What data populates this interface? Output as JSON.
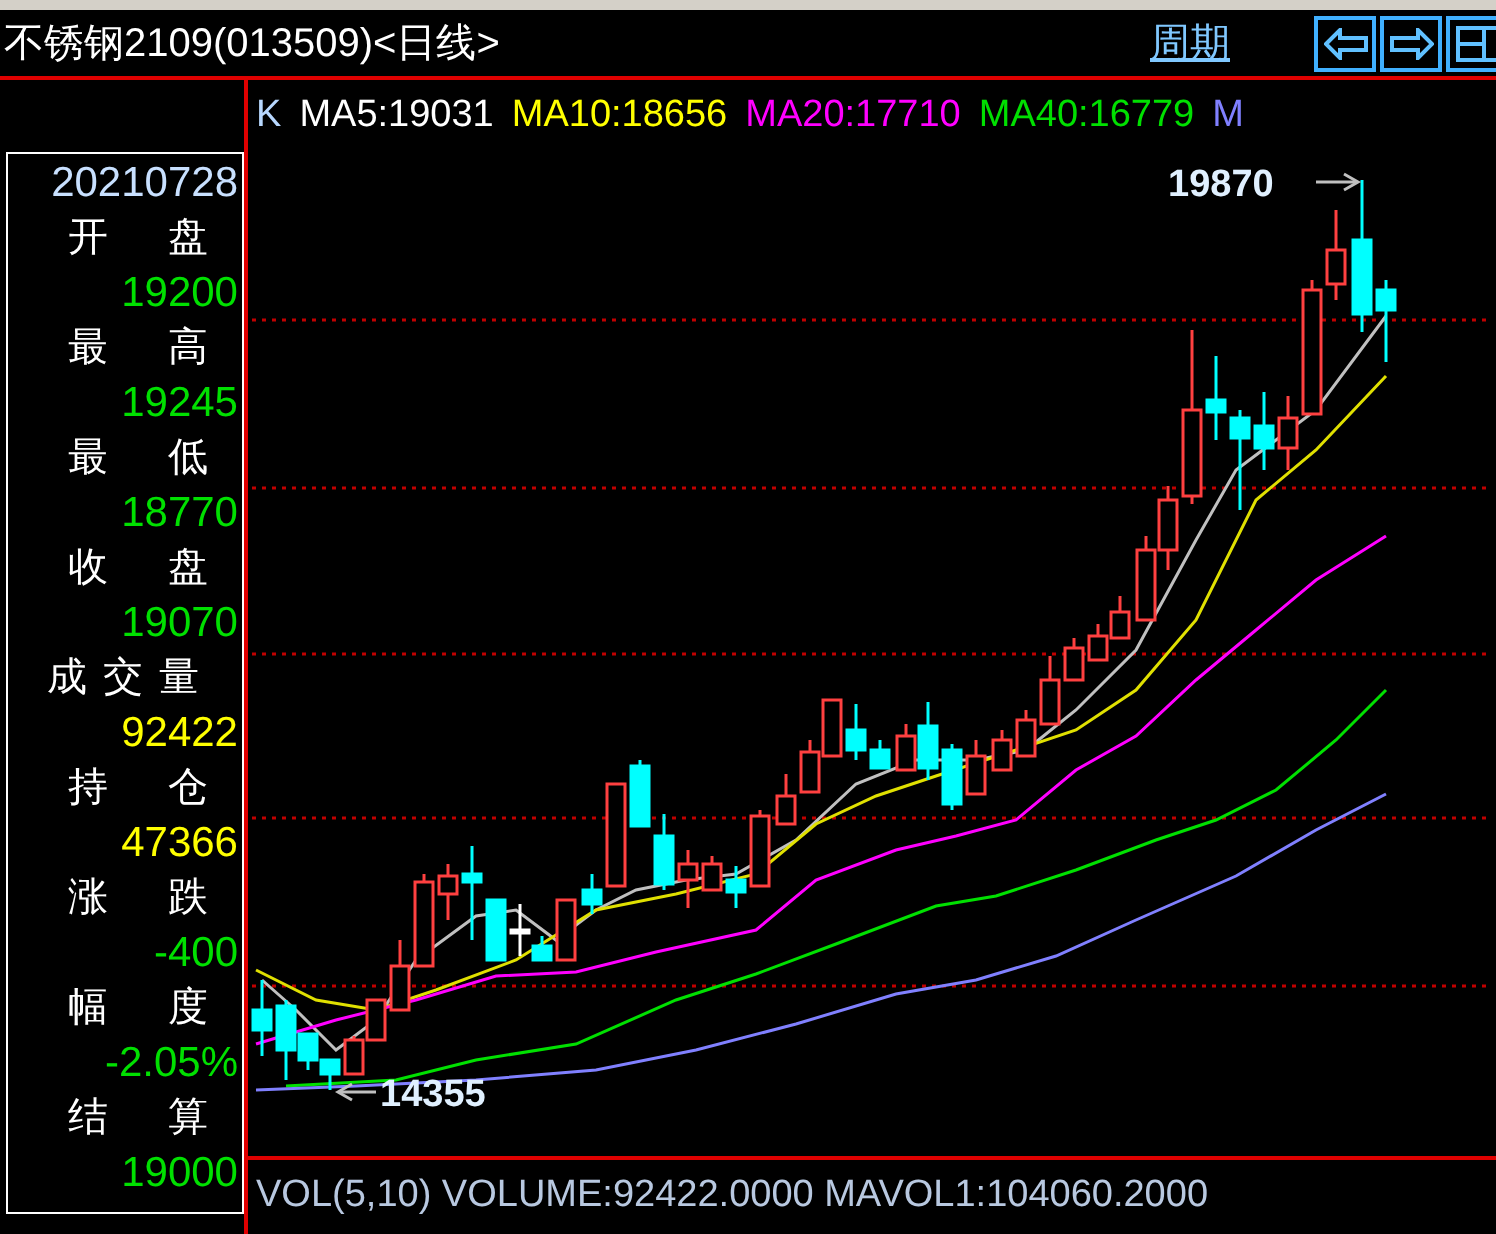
{
  "title": "不锈钢2109(013509)<日线>",
  "period_link": "周期",
  "legend": [
    {
      "label": "K",
      "color": "#b8d8ff"
    },
    {
      "label": "MA5:19031",
      "color": "#ffffff"
    },
    {
      "label": "MA10:18656",
      "color": "#ffff00"
    },
    {
      "label": "MA20:17710",
      "color": "#ff00ff"
    },
    {
      "label": "MA40:16779",
      "color": "#00e000"
    },
    {
      "label": "M",
      "color": "#8080ff"
    }
  ],
  "info_panel": {
    "date": "20210728",
    "fields": [
      {
        "label": "开盘",
        "value": "19200",
        "color": "#00e000"
      },
      {
        "label": "最高",
        "value": "19245",
        "color": "#00e000"
      },
      {
        "label": "最低",
        "value": "18770",
        "color": "#00e000"
      },
      {
        "label": "收盘",
        "value": "19070",
        "color": "#00e000"
      },
      {
        "label": "成交量",
        "value": "92422",
        "color": "#ffff00"
      },
      {
        "label": "持仓",
        "value": "47366",
        "color": "#ffff00"
      },
      {
        "label": "涨跌",
        "value": "-400",
        "color": "#00e000"
      },
      {
        "label": "幅度",
        "value": "-2.05%",
        "color": "#00e000"
      },
      {
        "label": "结算",
        "value": "19000",
        "color": "#00e000"
      }
    ]
  },
  "high_label": "19870",
  "low_label": "14355",
  "volume_legend": "VOL(5,10) VOLUME:92422.0000 MAVOL1:104060.2000"
}
